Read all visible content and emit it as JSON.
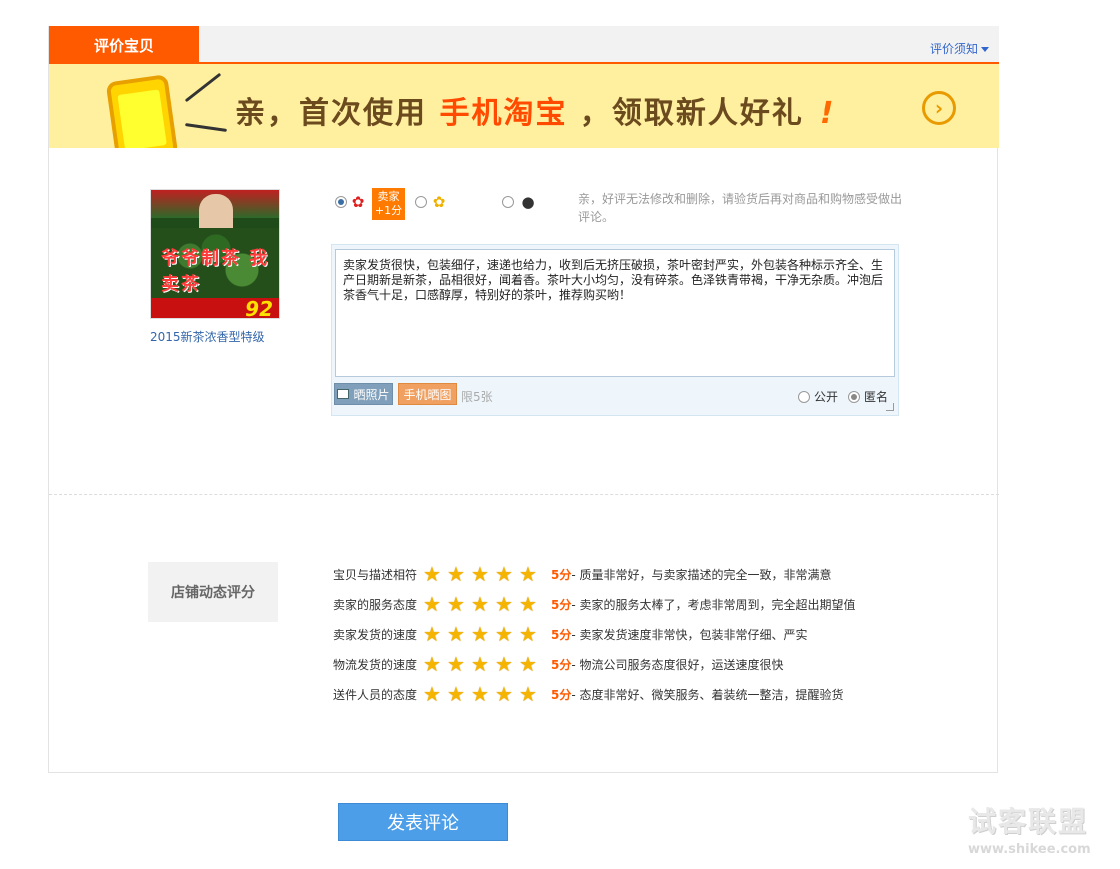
{
  "header": {
    "tab_label": "评价宝贝",
    "notice_link": "评价须知"
  },
  "banner": {
    "text_prefix": "亲，首次使用",
    "text_highlight": "手机淘宝",
    "text_suffix": "，领取新人好礼",
    "exclamation": "!",
    "arrow": "›",
    "colors": {
      "background": "#fff0a0",
      "highlight": "#ff4a00",
      "text": "#6b4a1e"
    }
  },
  "product": {
    "name": "2015新茶浓香型特级",
    "image_title": "爷爷制茶 我卖茶",
    "image_price": "92"
  },
  "review": {
    "rating_options": [
      {
        "icon": "red-flower-icon",
        "selected": true
      },
      {
        "icon": "yellow-flower-icon",
        "selected": false
      },
      {
        "icon": "bomb-icon",
        "selected": false
      }
    ],
    "seller_badge": [
      "卖家",
      "+1分"
    ],
    "hint": "亲，好评无法修改和删除，请验货后再对商品和购物感受做出评论。",
    "content": "卖家发货很快，包装细仔，速递也给力，收到后无挤压破损，茶叶密封严实，外包装各种标示齐全、生产日期新是新茶，品相很好，闻着香。茶叶大小均匀，没有碎茶。色泽铁青带褐，干净无杂质。冲泡后茶香气十足，口感醇厚，特别好的茶叶，推荐购买哟！",
    "photo_button": "晒照片",
    "mobile_photo_button": "手机晒图",
    "limit": "限5张",
    "visibility": {
      "public": "公开",
      "anonymous": "匿名",
      "selected": "anonymous"
    }
  },
  "shop_rating": {
    "title": "店铺动态评分",
    "rows": [
      {
        "label": "宝贝与描述相符",
        "stars": 5,
        "score": "5分",
        "desc": " - 质量非常好，与卖家描述的完全一致，非常满意"
      },
      {
        "label": "卖家的服务态度",
        "stars": 5,
        "score": "5分",
        "desc": " - 卖家的服务太棒了，考虑非常周到，完全超出期望值"
      },
      {
        "label": "卖家发货的速度",
        "stars": 5,
        "score": "5分",
        "desc": " - 卖家发货速度非常快，包装非常仔细、严实"
      },
      {
        "label": "物流发货的速度",
        "stars": 5,
        "score": "5分",
        "desc": " - 物流公司服务态度很好，运送速度很快"
      },
      {
        "label": "送件人员的态度",
        "stars": 5,
        "score": "5分",
        "desc": " - 态度非常好、微笑服务、着装统一整洁，提醒验货"
      }
    ]
  },
  "submit": {
    "label": "发表评论"
  },
  "watermark": {
    "name": "试客联盟",
    "url": "www.shikee.com"
  }
}
